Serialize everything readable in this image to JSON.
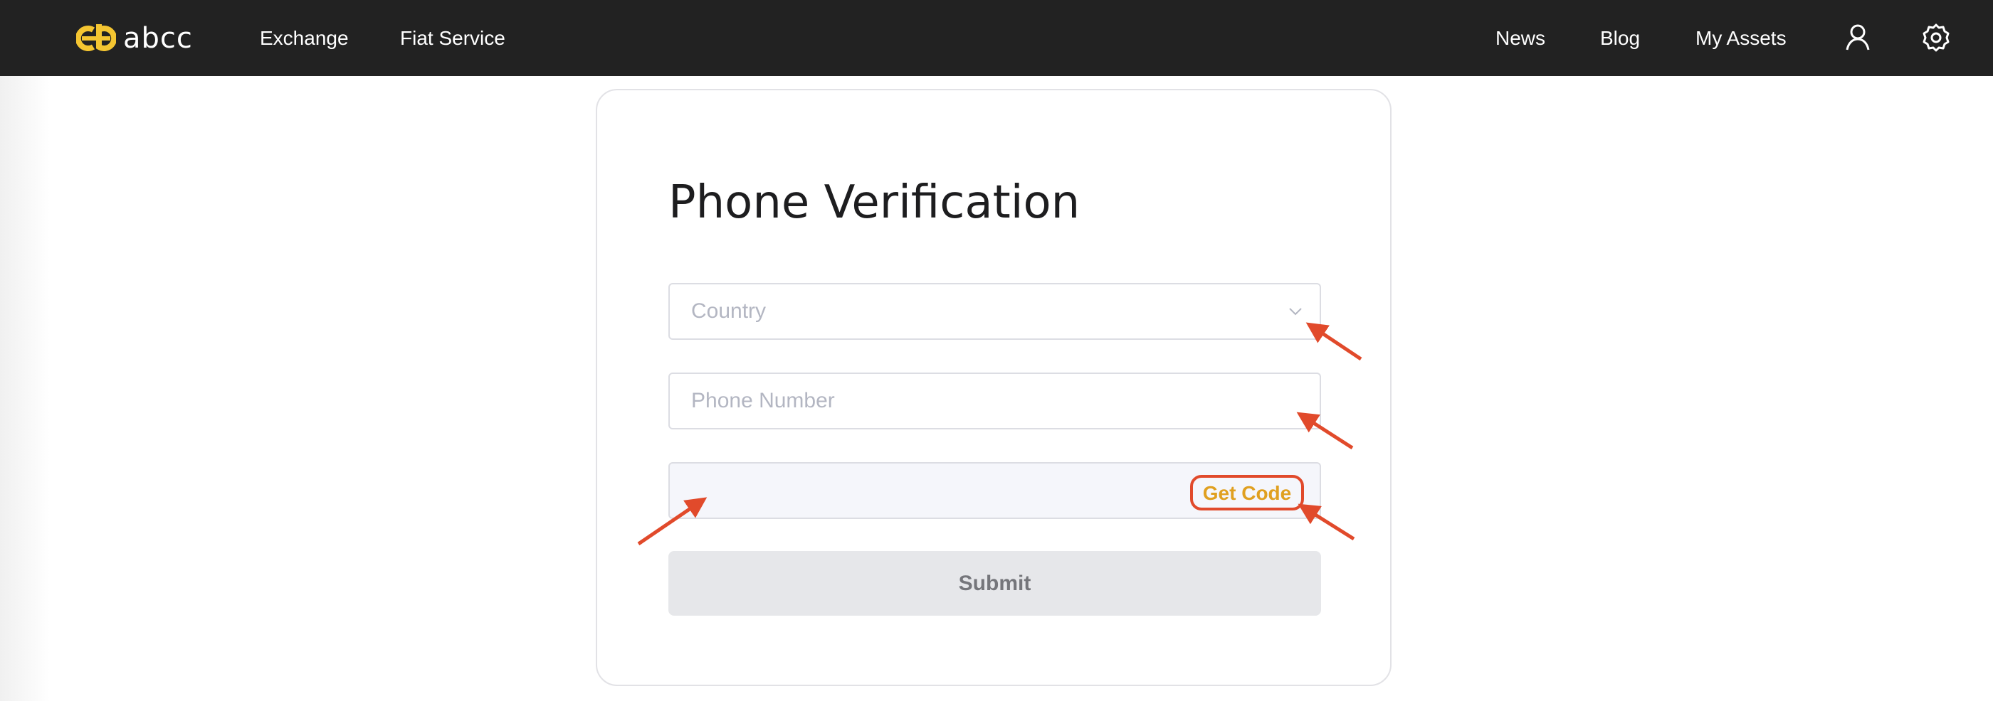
{
  "header": {
    "logo_text": "abcc",
    "brand_color": "#f4c531",
    "nav_left": [
      "Exchange",
      "Fiat Service"
    ],
    "nav_right": [
      "News",
      "Blog",
      "My Assets"
    ],
    "icons": [
      "user-icon",
      "gear-icon"
    ]
  },
  "form": {
    "title": "Phone Verification",
    "country_placeholder": "Country",
    "phone_placeholder": "Phone Number",
    "code_placeholder": "",
    "get_code_label": "Get Code",
    "submit_label": "Submit"
  },
  "colors": {
    "header_bg": "#222222",
    "accent": "#e0a020",
    "annotation": "#e14a2b"
  }
}
